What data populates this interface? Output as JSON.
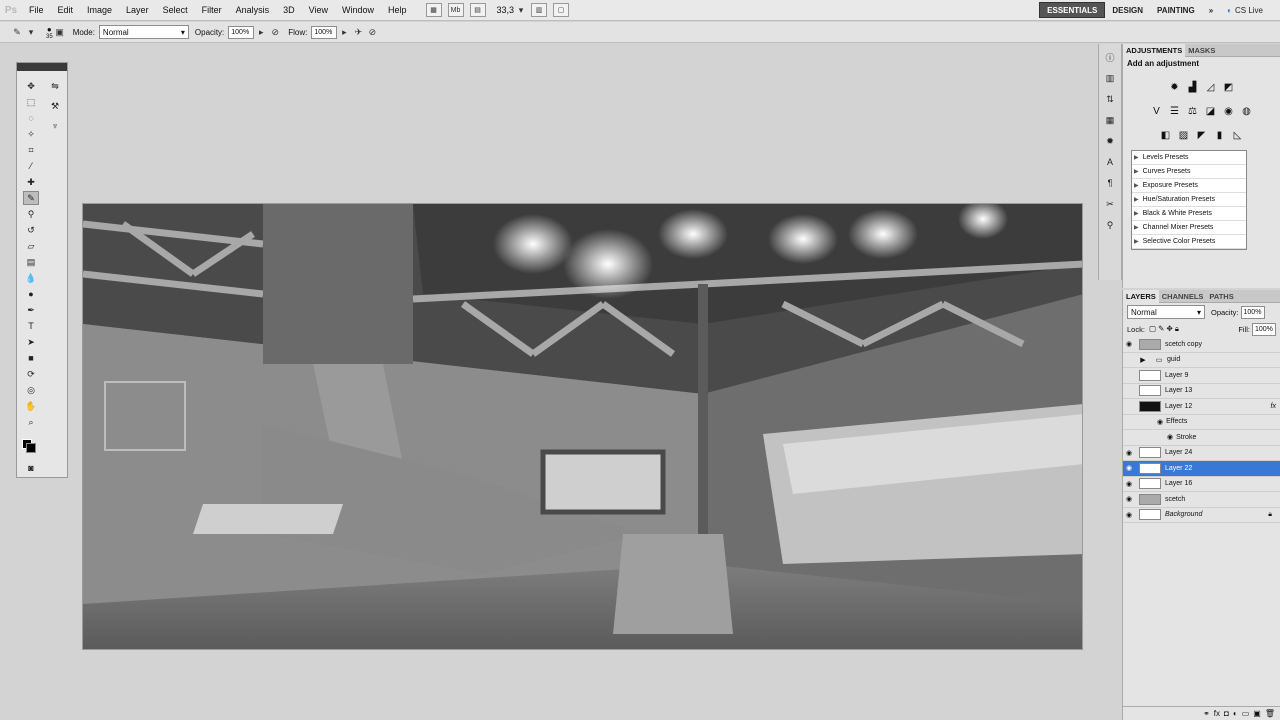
{
  "menubar": {
    "logo": "Ps",
    "items": [
      "File",
      "Edit",
      "Image",
      "Layer",
      "Select",
      "Filter",
      "Analysis",
      "3D",
      "View",
      "Window",
      "Help"
    ],
    "zoom": "33,3",
    "workspaces": [
      "ESSENTIALS",
      "DESIGN",
      "PAINTING"
    ],
    "cs_live": "CS Live"
  },
  "options": {
    "brush_size": "35",
    "mode_label": "Mode:",
    "mode_value": "Normal",
    "opacity_label": "Opacity:",
    "opacity_value": "100%",
    "flow_label": "Flow:",
    "flow_value": "100%"
  },
  "adjustments": {
    "tabs": [
      "ADJUSTMENTS",
      "MASKS"
    ],
    "title": "Add an adjustment",
    "presets": [
      "Levels Presets",
      "Curves Presets",
      "Exposure Presets",
      "Hue/Saturation Presets",
      "Black & White Presets",
      "Channel Mixer Presets",
      "Selective Color Presets"
    ]
  },
  "layers": {
    "tabs": [
      "LAYERS",
      "CHANNELS",
      "PATHS"
    ],
    "blend_mode": "Normal",
    "opacity_label": "Opacity:",
    "opacity_value": "100%",
    "lock_label": "Lock:",
    "fill_label": "Fill:",
    "fill_value": "100%",
    "items": [
      {
        "name": "scetch copy"
      },
      {
        "name": "guid"
      },
      {
        "name": "Layer 9"
      },
      {
        "name": "Layer 13"
      },
      {
        "name": "Layer 12",
        "fx": "fx"
      },
      {
        "name": "Effects"
      },
      {
        "name": "Stroke"
      },
      {
        "name": "Layer 24"
      },
      {
        "name": "Layer 22"
      },
      {
        "name": "Layer 16"
      },
      {
        "name": "scetch"
      },
      {
        "name": "Background"
      }
    ]
  },
  "colors": {
    "selection": "#3a78d6",
    "accent_active": "#555555"
  }
}
